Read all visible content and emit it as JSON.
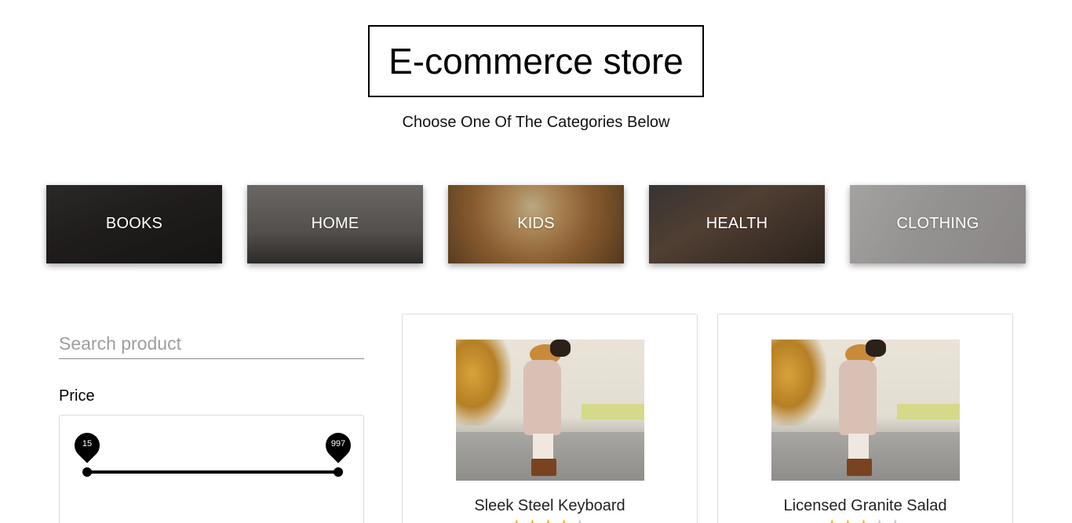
{
  "header": {
    "title": "E-commerce store",
    "subtitle": "Choose One Of The Categories Below"
  },
  "categories": [
    {
      "label": "BOOKS"
    },
    {
      "label": "HOME"
    },
    {
      "label": "KIDS"
    },
    {
      "label": "HEALTH"
    },
    {
      "label": "CLOTHING"
    }
  ],
  "filters": {
    "search": {
      "placeholder": "Search product",
      "value": ""
    },
    "price": {
      "label": "Price",
      "min": "15",
      "max": "997"
    }
  },
  "products": [
    {
      "name": "Sleek Steel Keyboard",
      "rating": 4,
      "max_rating": 5
    },
    {
      "name": "Licensed Granite Salad",
      "rating": 3,
      "max_rating": 5
    }
  ]
}
